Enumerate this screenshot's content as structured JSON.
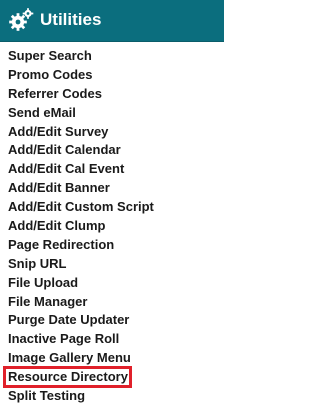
{
  "header": {
    "title": "Utilities",
    "icon": "gears-icon",
    "background": "#0b6e7e"
  },
  "menu": {
    "items": [
      {
        "label": "Super Search"
      },
      {
        "label": "Promo Codes"
      },
      {
        "label": "Referrer Codes"
      },
      {
        "label": "Send eMail"
      },
      {
        "label": "Add/Edit Survey"
      },
      {
        "label": "Add/Edit Calendar"
      },
      {
        "label": "Add/Edit Cal Event"
      },
      {
        "label": "Add/Edit Banner"
      },
      {
        "label": "Add/Edit Custom Script"
      },
      {
        "label": "Add/Edit Clump"
      },
      {
        "label": "Page Redirection"
      },
      {
        "label": "Snip URL"
      },
      {
        "label": "File Upload"
      },
      {
        "label": "File Manager"
      },
      {
        "label": "Purge Date Updater"
      },
      {
        "label": "Inactive Page Roll"
      },
      {
        "label": "Image Gallery Menu"
      },
      {
        "label": "Resource Directory",
        "highlighted": true
      },
      {
        "label": "Split Testing"
      }
    ],
    "highlight_color": "#e0202a"
  }
}
